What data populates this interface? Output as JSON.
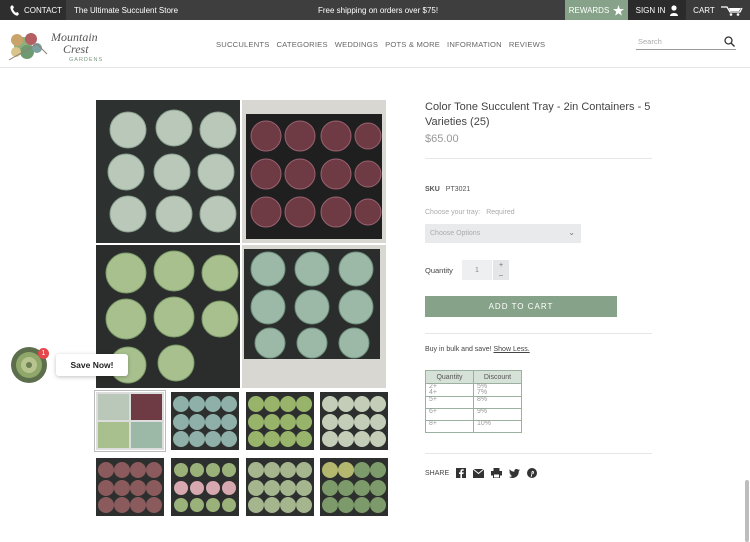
{
  "topbar": {
    "contact": "CONTACT",
    "store_tagline": "The Ultimate Succulent Store",
    "shipping": "Free shipping on orders over $75!",
    "rewards": "REWARDS",
    "sign_in": "SIGN IN",
    "cart": "CART"
  },
  "logo": {
    "line1": "Mountain",
    "line2": "Crest",
    "line3": "GARDENS"
  },
  "nav": [
    "SUCCULENTS",
    "CATEGORIES",
    "WEDDINGS",
    "POTS & MORE",
    "INFORMATION",
    "REVIEWS"
  ],
  "search": {
    "placeholder": "Search"
  },
  "product": {
    "title": "Color Tone Succulent Tray - 2in Containers - 5 Varieties (25)",
    "price": "$65.00",
    "sku_label": "SKU",
    "sku": "PT3021",
    "choose_label": "Choose your tray:",
    "required": "Required",
    "select_placeholder": "Choose Options",
    "quantity_label": "Quantity",
    "quantity": "1",
    "add_to_cart": "ADD TO CART",
    "bulk_text": "Buy in bulk and save!",
    "show_less": "Show Less.",
    "discount_headers": [
      "Quantity",
      "Discount"
    ],
    "discount_rows": [
      [
        "2+",
        "5%"
      ],
      [
        "4+",
        "7%"
      ],
      [
        "5+",
        "8%"
      ],
      [
        "6+",
        "9%"
      ],
      [
        "8+",
        "10%"
      ]
    ],
    "share_label": "SHARE"
  },
  "save_now": {
    "label": "Save Now!",
    "badge": "1"
  },
  "colors": {
    "accent_green": "#86a389",
    "topbar": "#3e3e3e",
    "badge_red": "#e4474c"
  },
  "icons": [
    "phone-icon",
    "star-icon",
    "user-icon",
    "cart-icon",
    "search-icon",
    "facebook-icon",
    "email-icon",
    "print-icon",
    "twitter-icon",
    "pinterest-icon"
  ]
}
